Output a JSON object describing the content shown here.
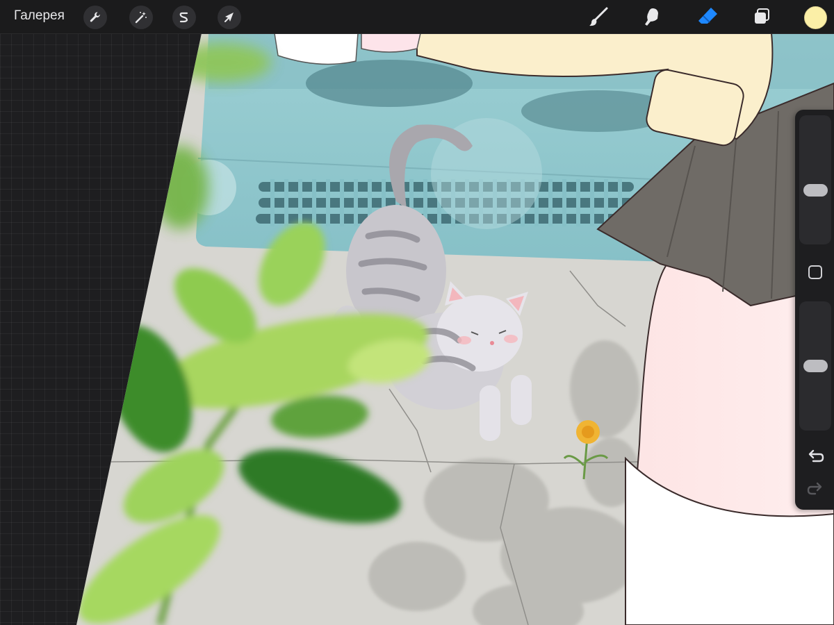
{
  "app": {
    "gallery_label": "Галерея"
  },
  "toolbar": {
    "left_tools": [
      {
        "name": "actions",
        "icon": "wrench-icon"
      },
      {
        "name": "adjustments",
        "icon": "magic-wand-icon"
      },
      {
        "name": "selection",
        "icon": "selection-s-icon"
      },
      {
        "name": "transform",
        "icon": "arrow-cursor-icon"
      }
    ],
    "right_tools": [
      {
        "name": "brush",
        "icon": "brush-icon",
        "active": false
      },
      {
        "name": "smudge",
        "icon": "smudge-icon",
        "active": false
      },
      {
        "name": "eraser",
        "icon": "eraser-icon",
        "active": true
      },
      {
        "name": "layers",
        "icon": "layers-icon",
        "active": false
      }
    ],
    "current_color": "#fbefa7"
  },
  "sidebar": {
    "brush_size_level": 0.4,
    "opacity_level": 0.5,
    "buttons": [
      {
        "name": "modify",
        "icon": "square-outline-icon"
      },
      {
        "name": "undo",
        "icon": "undo-icon"
      },
      {
        "name": "redo",
        "icon": "redo-icon"
      }
    ]
  },
  "colors": {
    "accent": "#1e88ff",
    "toolbar_bg": "#1b1b1c",
    "workspace_bg": "#1e1e20"
  }
}
